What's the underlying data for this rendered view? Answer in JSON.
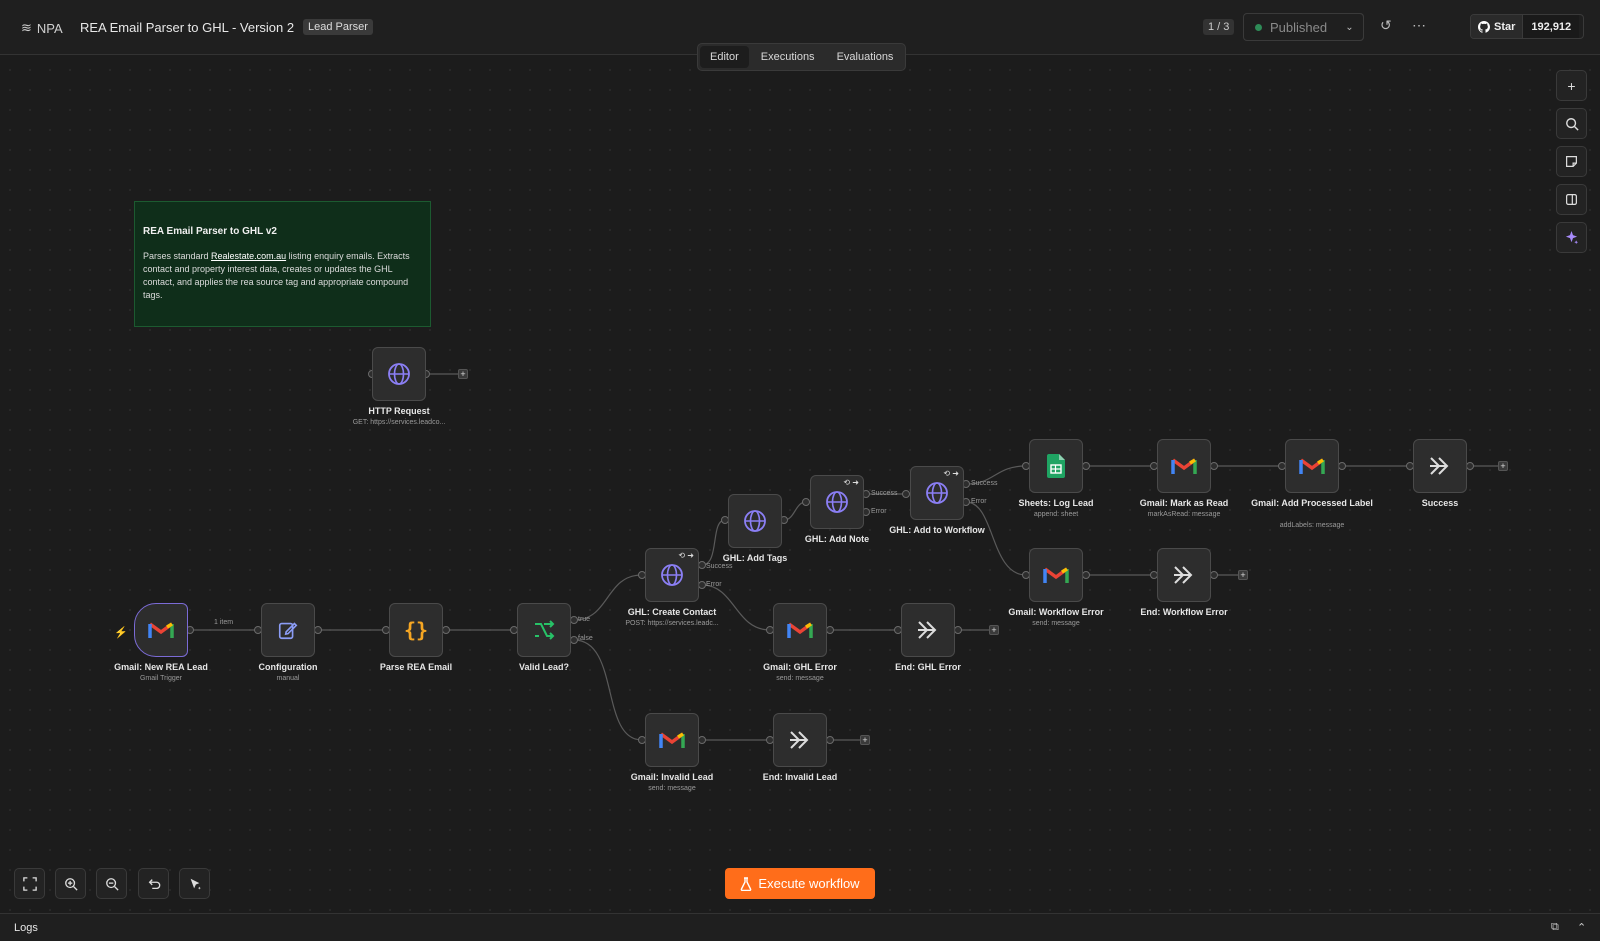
{
  "header": {
    "workspace": "NPA",
    "workflow_title": "REA Email Parser to GHL - Version 2",
    "tag": "Lead Parser",
    "version": "1 / 3",
    "status": "Published",
    "github_star_label": "Star",
    "github_star_count": "192,912"
  },
  "tabs": [
    {
      "label": "Editor",
      "active": true
    },
    {
      "label": "Executions",
      "active": false
    },
    {
      "label": "Evaluations",
      "active": false
    }
  ],
  "sticky": {
    "title": "REA Email Parser to GHL v2",
    "body_before_link": "Parses standard ",
    "link_text": "Realestate.com.au",
    "body_after_link": " listing enquiry emails. Extracts contact and property interest data, creates or updates the GHL contact, and applies the rea source tag and appropriate compound tags."
  },
  "nodes": {
    "http": {
      "label": "HTTP Request",
      "sub": "GET: https://services.leadco..."
    },
    "gmail_trigger": {
      "label": "Gmail: New REA Lead",
      "sub": "Gmail Trigger"
    },
    "config": {
      "label": "Configuration",
      "sub": "manual"
    },
    "parse": {
      "label": "Parse REA Email",
      "sub": ""
    },
    "valid": {
      "label": "Valid Lead?",
      "sub": ""
    },
    "create_contact": {
      "label": "GHL: Create Contact",
      "sub": "POST: https://services.leadc..."
    },
    "add_tags": {
      "label": "GHL: Add Tags",
      "sub": ""
    },
    "add_note": {
      "label": "GHL: Add Note",
      "sub": ""
    },
    "add_workflow": {
      "label": "GHL: Add to Workflow",
      "sub": ""
    },
    "sheets_log": {
      "label": "Sheets: Log Lead",
      "sub": "append: sheet"
    },
    "mark_read": {
      "label": "Gmail: Mark as Read",
      "sub": "markAsRead: message"
    },
    "add_label": {
      "label": "Gmail: Add Processed Label",
      "sub": "addLabels: message"
    },
    "success": {
      "label": "Success",
      "sub": ""
    },
    "wf_error": {
      "label": "Gmail: Workflow Error",
      "sub": "send: message"
    },
    "end_wf_error": {
      "label": "End: Workflow Error",
      "sub": ""
    },
    "ghl_error": {
      "label": "Gmail: GHL Error",
      "sub": "send: message"
    },
    "end_ghl_error": {
      "label": "End: GHL Error",
      "sub": ""
    },
    "invalid": {
      "label": "Gmail: Invalid Lead",
      "sub": "send: message"
    },
    "end_invalid": {
      "label": "End: Invalid Lead",
      "sub": ""
    }
  },
  "edge_labels": {
    "items": "1 item",
    "true": "true",
    "false": "false",
    "success": "Success",
    "error": "Error"
  },
  "execute_button": "Execute workflow",
  "logs_label": "Logs",
  "colors": {
    "accent": "#ff6d1a",
    "http_icon": "#8b7ff5",
    "switch_icon": "#27c267",
    "code_icon": "#f5a623",
    "sticky_bg": "#0f2e1a",
    "published_dot": "#2e8b57"
  },
  "icons": {
    "http": "globe-icon",
    "gmail": "gmail-icon",
    "config": "edit-icon",
    "code": "code-braces-icon",
    "if": "switch-icon",
    "sheets": "google-sheets-icon",
    "noop": "double-chevron-right-icon"
  }
}
